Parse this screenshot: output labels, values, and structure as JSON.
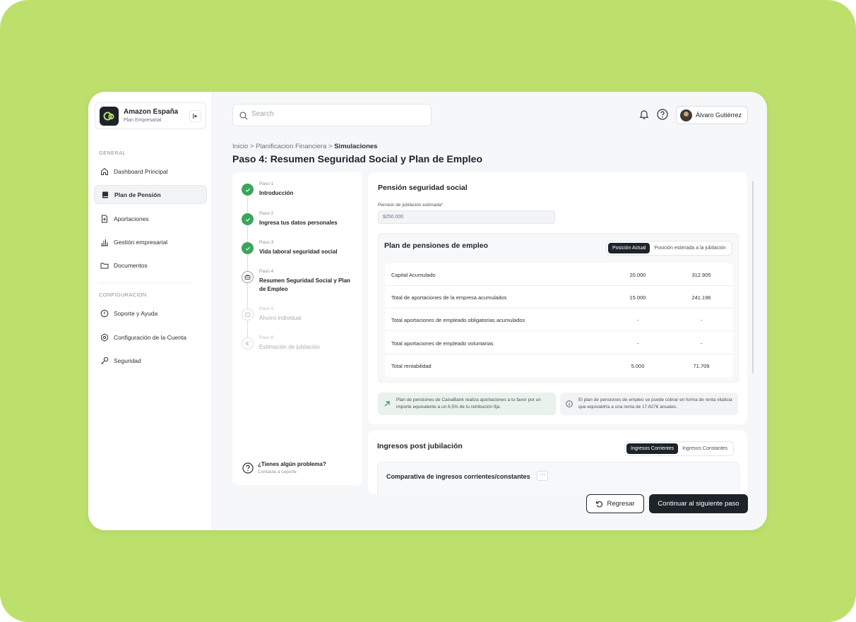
{
  "org": {
    "name": "Amazon España",
    "subtitle": "Plan Empresarial"
  },
  "sidebar": {
    "section_general": "GENERAL",
    "section_config": "CONFIGURACION",
    "items": [
      {
        "label": "Dashboard Principal",
        "icon": "home-icon"
      },
      {
        "label": "Plan de Pensión",
        "icon": "book-icon",
        "active": true
      },
      {
        "label": "Aportaciones",
        "icon": "file-plus-icon"
      },
      {
        "label": "Gestión empresarial",
        "icon": "bar-chart-icon"
      },
      {
        "label": "Documentos",
        "icon": "folder-icon"
      },
      {
        "label": "Soporte y Ayuda",
        "icon": "alert-circle-icon"
      },
      {
        "label": "Configuración de la Cuenta",
        "icon": "gear-icon"
      },
      {
        "label": "Seguridad",
        "icon": "key-icon"
      }
    ]
  },
  "header": {
    "search_placeholder": "Search",
    "user_name": "Álvaro Gutiérrez"
  },
  "breadcrumb": {
    "part1": "Inicio",
    "sep": ">",
    "part2": "Planificacion Financiera",
    "current": "Simulaciones"
  },
  "page_title": "Paso 4: Resumen Seguridad Social y Plan de Empleo",
  "steps": [
    {
      "num": "Paso 1",
      "title": "Introducción",
      "status": "done"
    },
    {
      "num": "Paso 2",
      "title": "Ingresa tus datos personales",
      "status": "done"
    },
    {
      "num": "Paso 3",
      "title": "Vida laboral seguridad social",
      "status": "done"
    },
    {
      "num": "Paso 4",
      "title": "Resumen Seguridad Social y Plan de Empleo",
      "status": "current"
    },
    {
      "num": "Paso 5",
      "title": "Ahorro individual",
      "status": "todo"
    },
    {
      "num": "Paso 6",
      "title": "Estimación de jubilación",
      "status": "todo"
    }
  ],
  "help": {
    "title": "¿Tienes algún problema?",
    "subtitle": "Contacta a soporte"
  },
  "social_security": {
    "title": "Pensión seguridad social",
    "field_label": "Pension de jubilación estimada*",
    "field_value": "$250.000"
  },
  "employment_plan": {
    "title": "Plan de pensiones de empleo",
    "toggle": [
      "Posición Actual",
      "Posición estimada a la jubilación"
    ],
    "rows": [
      {
        "label": "Capital Acumulado",
        "current": "20.000",
        "estimated": "312.905"
      },
      {
        "label": "Total de aportaciones de la empresa acumulados",
        "current": "15.000",
        "estimated": "241.196"
      },
      {
        "label": "Total aportaciones de empleado obligatorias acumulados",
        "current": "-",
        "estimated": "-"
      },
      {
        "label": "Total aportaciones de empleado voluntarias",
        "current": "-",
        "estimated": "-"
      },
      {
        "label": "Total rentabilidad",
        "current": "5.000",
        "estimated": "71.709"
      }
    ],
    "note_left": "Plan de pensiones de CaixaBank realiza aportaciones a tu favor por un importe equivalente a un 6,5% de tu retribución fija.",
    "note_right": "El plan de pensiones de empleo se puede cobrar en forma de renta vitalicia que equivaldría a una renta de 17.627€ anuales."
  },
  "post_retirement": {
    "title": "Ingresos post jubilación",
    "toggle": [
      "Ingresos Corrientes",
      "Ingresos Constantes"
    ],
    "compare_title": "Comparativa de ingresos corrientes/constantes",
    "dots": "···"
  },
  "footer": {
    "back": "Regresar",
    "next": "Continuar al siguiente paso"
  },
  "colors": {
    "backdrop": "#bde06c",
    "primary": "#1d2329",
    "success": "#3ba55c"
  }
}
